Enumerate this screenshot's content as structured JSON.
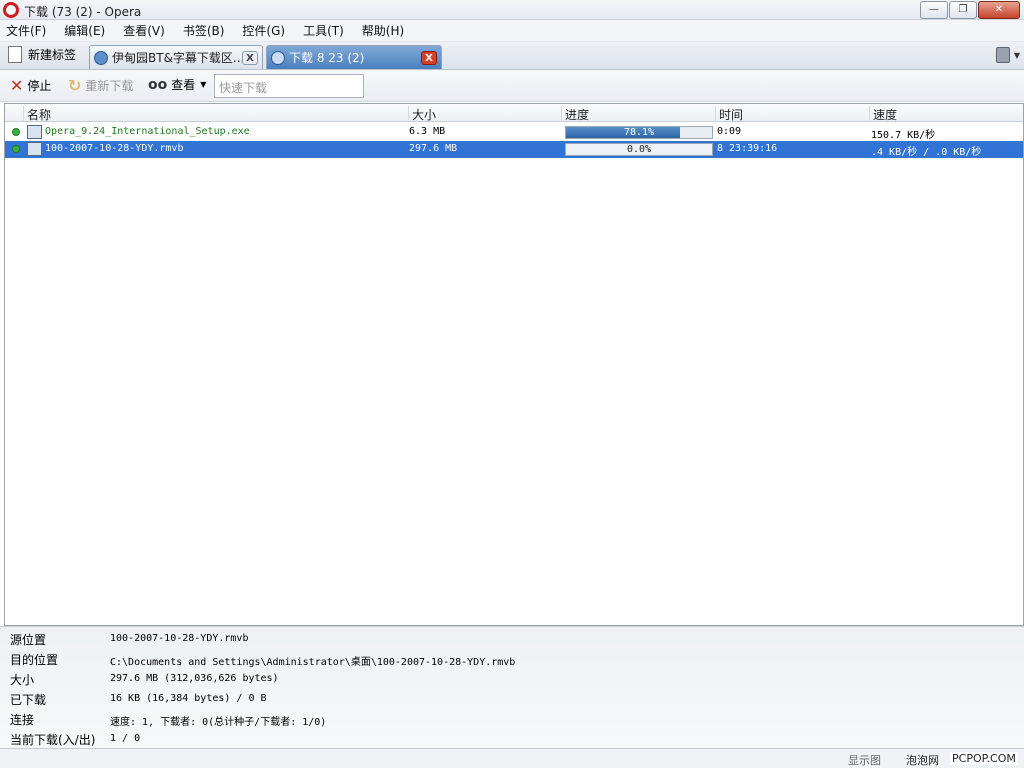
{
  "window": {
    "title": "下载 (73 (2) - Opera",
    "min": "—",
    "max": "❐",
    "close": "✕"
  },
  "menu": [
    "文件(F)",
    "编辑(E)",
    "查看(V)",
    "书签(B)",
    "控件(G)",
    "工具(T)",
    "帮助(H)"
  ],
  "tabs": {
    "new_tab": "新建标签",
    "items": [
      {
        "label": "伊甸园BT&字幕下载区...",
        "close": "X"
      },
      {
        "label": "下载 8 23 (2)",
        "close": "X"
      }
    ]
  },
  "toolbar": {
    "stop": "停止",
    "redownload": "重新下载",
    "view": "查看",
    "quick_download_placeholder": "快速下载"
  },
  "columns": [
    "名称",
    "大小",
    "进度",
    "时间",
    "速度"
  ],
  "downloads": [
    {
      "name": "Opera_9.24_International_Setup.exe",
      "size": "6.3 MB",
      "progress_text": "78.1%",
      "progress": 0.781,
      "time": "0:09",
      "speed": "150.7 KB/秒"
    },
    {
      "name": "100-2007-10-28-YDY.rmvb",
      "size": "297.6 MB",
      "progress_text": "0.0%",
      "progress": 0.0,
      "time": "8 23:39:16",
      "speed": ".4 KB/秒 / .0 KB/秒"
    }
  ],
  "details": [
    {
      "label": "源位置",
      "value": "100-2007-10-28-YDY.rmvb"
    },
    {
      "label": "目的位置",
      "value": "C:\\Documents and Settings\\Administrator\\桌面\\100-2007-10-28-YDY.rmvb"
    },
    {
      "label": "大小",
      "value": "297.6 MB (312,036,626 bytes)"
    },
    {
      "label": "已下载",
      "value": "16 KB (16,384 bytes) / 0 B"
    },
    {
      "label": "连接",
      "value": "速度: 1, 下载者: 0(总计种子/下载者: 1/0)"
    },
    {
      "label": "当前下载(入/出)",
      "value": "1 / 0"
    }
  ],
  "status": {
    "show_images": "显示图",
    "watermark": "泡泡网",
    "site": "PCPOP.COM"
  }
}
